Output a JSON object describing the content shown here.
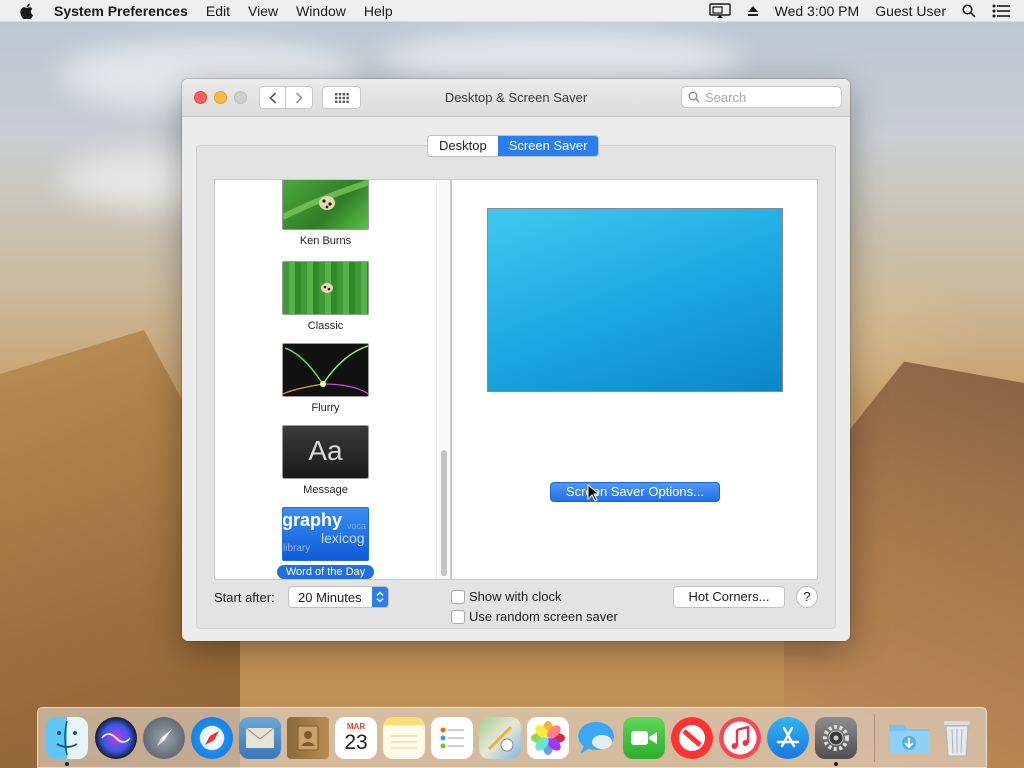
{
  "menubar": {
    "app_name": "System Preferences",
    "menus": [
      "Edit",
      "View",
      "Window",
      "Help"
    ],
    "clock": "Wed 3:00 PM",
    "user": "Guest User"
  },
  "window": {
    "title": "Desktop & Screen Saver",
    "search_placeholder": "Search",
    "tabs": [
      {
        "label": "Desktop",
        "active": false
      },
      {
        "label": "Screen Saver",
        "active": true
      }
    ]
  },
  "screen_savers": [
    {
      "label": "Ken Burns",
      "selected": false
    },
    {
      "label": "Classic",
      "selected": false
    },
    {
      "label": "Flurry",
      "selected": false
    },
    {
      "label": "Message",
      "selected": false,
      "thumb_text": "Aa"
    },
    {
      "label": "Word of the Day",
      "selected": true,
      "thumb_text": [
        "graphy",
        "lexicog",
        "library",
        "voca"
      ]
    }
  ],
  "preview": {
    "options_button": "Screen Saver Options...",
    "colors": [
      "#3fc8f2",
      "#0c86c6"
    ]
  },
  "controls": {
    "start_after_label": "Start after:",
    "start_after_value": "20 Minutes",
    "show_with_clock": {
      "label": "Show with clock",
      "checked": false
    },
    "random_saver": {
      "label": "Use random screen saver",
      "checked": false
    },
    "hot_corners": "Hot Corners...",
    "help": "?"
  },
  "dock": {
    "apps": [
      {
        "name": "Finder",
        "icon": "finder-icon",
        "running": true
      },
      {
        "name": "Siri",
        "icon": "siri-icon",
        "running": false
      },
      {
        "name": "Launchpad",
        "icon": "launchpad-icon",
        "running": false
      },
      {
        "name": "Safari",
        "icon": "safari-icon",
        "running": false
      },
      {
        "name": "Mail",
        "icon": "mail-icon",
        "running": false
      },
      {
        "name": "Contacts",
        "icon": "contacts-icon",
        "running": false
      },
      {
        "name": "Calendar",
        "icon": "calendar-icon",
        "running": false,
        "month": "MAR",
        "day": "23"
      },
      {
        "name": "Notes",
        "icon": "notes-icon",
        "running": false
      },
      {
        "name": "Reminders",
        "icon": "reminders-icon",
        "running": false
      },
      {
        "name": "Maps",
        "icon": "maps-icon",
        "running": false
      },
      {
        "name": "Photos",
        "icon": "photos-icon",
        "running": false
      },
      {
        "name": "Messages",
        "icon": "messages-icon",
        "running": false
      },
      {
        "name": "FaceTime",
        "icon": "facetime-icon",
        "running": false
      },
      {
        "name": "News",
        "icon": "news-icon",
        "running": false
      },
      {
        "name": "iTunes",
        "icon": "itunes-icon",
        "running": false
      },
      {
        "name": "App Store",
        "icon": "app-store-icon",
        "running": false
      },
      {
        "name": "System Preferences",
        "icon": "system-preferences-icon",
        "running": true
      },
      {
        "name": "Downloads",
        "icon": "downloads-folder-icon",
        "running": false
      },
      {
        "name": "Trash",
        "icon": "trash-icon",
        "running": false
      }
    ]
  }
}
